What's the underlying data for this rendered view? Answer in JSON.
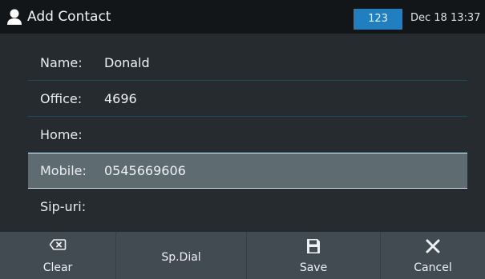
{
  "titlebar": {
    "title": "Add Contact",
    "icon": "person-icon",
    "input_mode": "123",
    "datetime": "Dec 18 13:37"
  },
  "fields": [
    {
      "label": "Name:",
      "value": "Donald"
    },
    {
      "label": "Office:",
      "value": "4696"
    },
    {
      "label": "Home:",
      "value": ""
    },
    {
      "label": "Mobile:",
      "value": "0545669606",
      "selected": true
    },
    {
      "label": "Sip-uri:",
      "value": ""
    }
  ],
  "softkeys": {
    "clear": {
      "label": "Clear",
      "icon": "backspace-icon"
    },
    "spdial": {
      "label": "Sp.Dial"
    },
    "save": {
      "label": "Save",
      "icon": "floppy-disk-icon"
    },
    "cancel": {
      "label": "Cancel",
      "icon": "close-icon"
    }
  },
  "colors": {
    "background": "#262b2f",
    "titlebar": "#121619",
    "badge": "#1f7fc0",
    "selected_row": "#5e6c72",
    "softkey_bar": "#424b51",
    "separator": "#1f4b5c"
  }
}
